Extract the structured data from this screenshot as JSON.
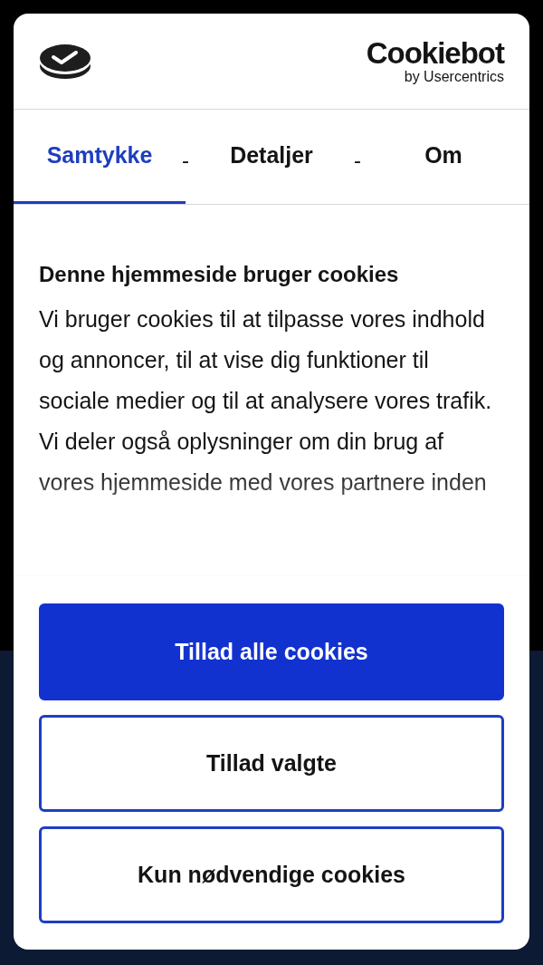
{
  "logo": {
    "name": "Cookiebot",
    "tagline": "by Usercentrics"
  },
  "tabs": [
    {
      "label": "Samtykke",
      "selected": true,
      "separator": "-"
    },
    {
      "label": "Detaljer",
      "selected": false,
      "separator": "-"
    },
    {
      "label": "Om",
      "selected": false
    }
  ],
  "heading": "Denne hjemmeside bruger cookies",
  "body": "Vi bruger cookies til at tilpasse vores indhold og annoncer, til at vise dig funktioner til sociale medier og til at analysere vores trafik. Vi deler også oplysninger om din brug af vores hjemmeside med vores partnere inden",
  "buttons": [
    {
      "label": "Tillad alle cookies",
      "kind": "primary"
    },
    {
      "label": "Tillad valgte",
      "kind": "outline"
    },
    {
      "label": "Kun nødvendige cookies",
      "kind": "outline"
    }
  ]
}
